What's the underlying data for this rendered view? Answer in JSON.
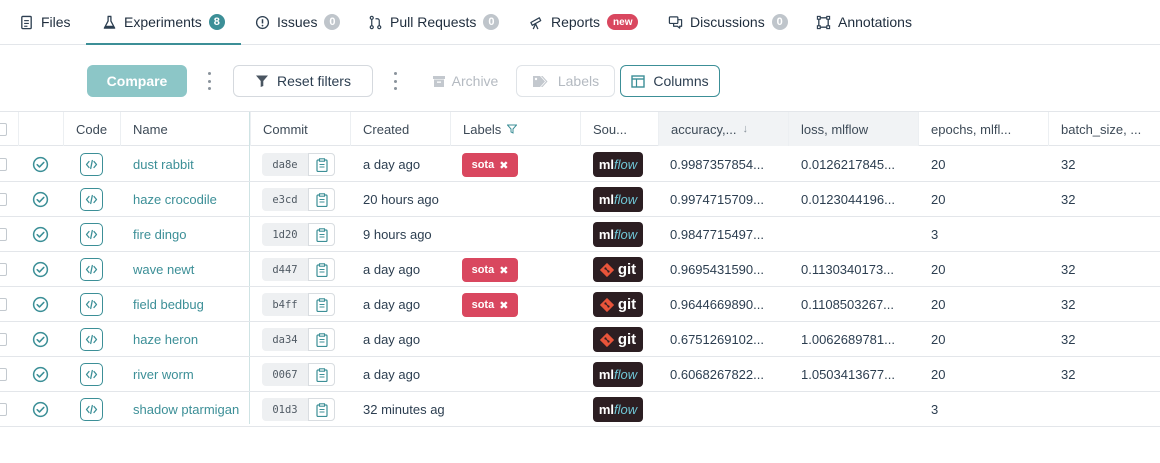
{
  "tabs": [
    {
      "label": "Files",
      "icon": "file-icon"
    },
    {
      "label": "Experiments",
      "icon": "flask-icon",
      "badge": "8"
    },
    {
      "label": "Issues",
      "icon": "alert-circle-icon",
      "badge": "0"
    },
    {
      "label": "Pull Requests",
      "icon": "pull-request-icon",
      "badge": "0"
    },
    {
      "label": "Reports",
      "icon": "telescope-icon",
      "badge": "new"
    },
    {
      "label": "Discussions",
      "icon": "chat-icon",
      "badge": "0"
    },
    {
      "label": "Annotations",
      "icon": "frame-icon"
    }
  ],
  "toolbar": {
    "compare": "Compare",
    "reset_filters": "Reset filters",
    "archive": "Archive",
    "labels": "Labels",
    "columns": "Columns"
  },
  "table": {
    "headers": {
      "code": "Code",
      "name": "Name",
      "commit": "Commit",
      "created": "Created",
      "labels": "Labels",
      "source": "Sou...",
      "accuracy": "accuracy,...",
      "loss": "loss, mlflow",
      "epochs": "epochs, mlfl...",
      "batch_size": "batch_size, ..."
    },
    "rows": [
      {
        "name": "dust rabbit",
        "commit": "da8e",
        "created": "a day ago",
        "label": "sota",
        "source": "mlflow",
        "accuracy": "0.9987357854...",
        "loss": "0.0126217845...",
        "epochs": "20",
        "batch_size": "32"
      },
      {
        "name": "haze crocodile",
        "commit": "e3cd",
        "created": "20 hours ago",
        "label": "",
        "source": "mlflow",
        "accuracy": "0.9974715709...",
        "loss": "0.0123044196...",
        "epochs": "20",
        "batch_size": "32"
      },
      {
        "name": "fire dingo",
        "commit": "1d20",
        "created": "9 hours ago",
        "label": "",
        "source": "mlflow",
        "accuracy": "0.9847715497...",
        "loss": "",
        "epochs": "3",
        "batch_size": ""
      },
      {
        "name": "wave newt",
        "commit": "d447",
        "created": "a day ago",
        "label": "sota",
        "source": "git",
        "accuracy": "0.9695431590...",
        "loss": "0.1130340173...",
        "epochs": "20",
        "batch_size": "32"
      },
      {
        "name": "field bedbug",
        "commit": "b4ff",
        "created": "a day ago",
        "label": "sota",
        "source": "git",
        "accuracy": "0.9644669890...",
        "loss": "0.1108503267...",
        "epochs": "20",
        "batch_size": "32"
      },
      {
        "name": "haze heron",
        "commit": "da34",
        "created": "a day ago",
        "label": "",
        "source": "git",
        "accuracy": "0.6751269102...",
        "loss": "1.0062689781...",
        "epochs": "20",
        "batch_size": "32"
      },
      {
        "name": "river worm",
        "commit": "0067",
        "created": "a day ago",
        "label": "",
        "source": "mlflow",
        "accuracy": "0.6068267822...",
        "loss": "1.0503413677...",
        "epochs": "20",
        "batch_size": "32"
      },
      {
        "name": "shadow ptarmigan",
        "commit": "01d3",
        "created": "32 minutes ag",
        "label": "",
        "source": "mlflow",
        "accuracy": "",
        "loss": "",
        "epochs": "3",
        "batch_size": ""
      }
    ]
  },
  "source_labels": {
    "ml": "ml",
    "flow": "flow",
    "git": "git"
  },
  "colors": {
    "accent": "#3c8f97",
    "label_red": "#d9475f",
    "compare_disabled": "#8cc6c7",
    "source_bg": "#2c1e22",
    "git_orange": "#e8543a"
  }
}
